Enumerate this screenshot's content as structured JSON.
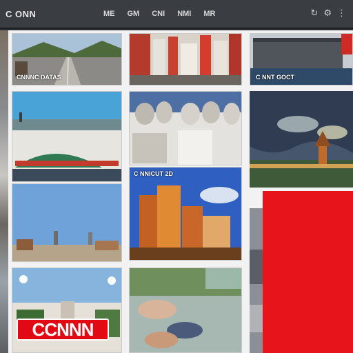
{
  "header": {
    "logo": "C ONN",
    "nav": [
      "ME",
      "GM",
      "CNI",
      "NMI",
      "MR"
    ],
    "icons": [
      "refresh-icon",
      "settings-icon",
      "menu-icon"
    ]
  },
  "tiles": {
    "highway": {
      "caption": "CNNNC DATAS"
    },
    "city_street": {
      "caption": ""
    },
    "tall_building": {
      "caption": "C NNT GOCT"
    },
    "harbour": {
      "caption": ""
    },
    "monuments": {
      "caption": ""
    },
    "night_temple": {
      "caption": ""
    },
    "stadium": {
      "caption": ""
    },
    "skyline": {
      "caption": "C NNICUT 2D"
    },
    "waterfront_city": {
      "caption": ""
    },
    "park_people": {
      "caption": ""
    },
    "town": {
      "caption": ""
    }
  },
  "brand": {
    "badge": "CCNNN",
    "color": "#e10a14"
  }
}
